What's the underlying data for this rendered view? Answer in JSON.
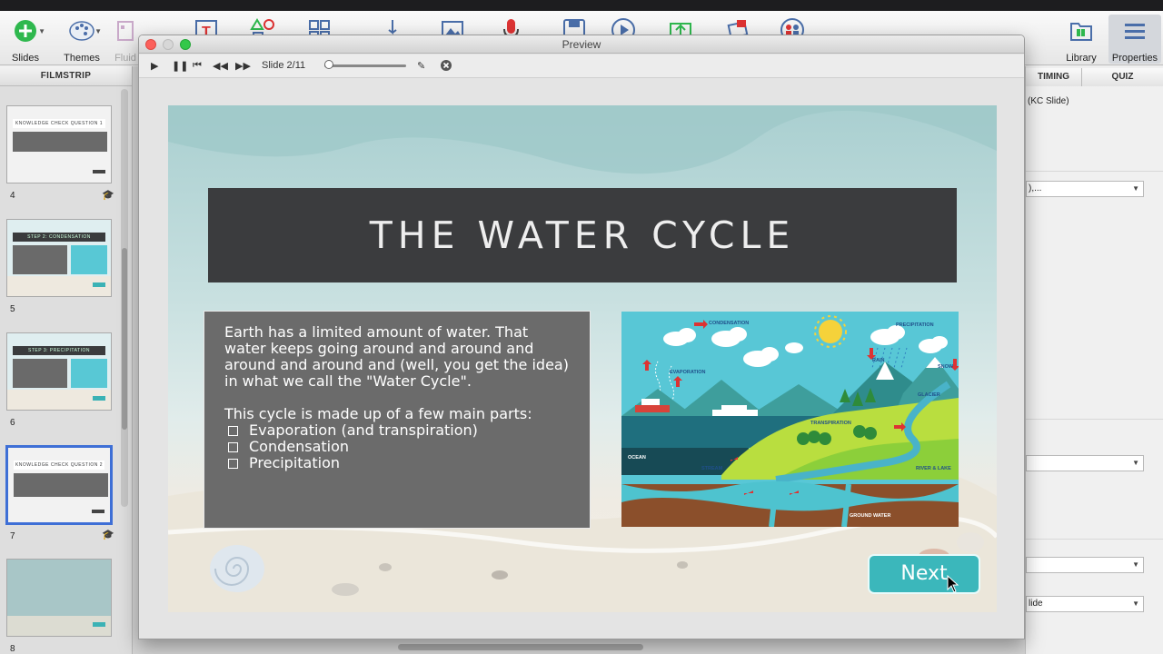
{
  "toolbar": {
    "items": [
      {
        "label": "Slides",
        "icon": "add-slide-icon"
      },
      {
        "label": "Themes",
        "icon": "palette-icon"
      },
      {
        "label": "Fluid",
        "icon": "fluid-boxes-icon"
      },
      {
        "label": "Library",
        "icon": "library-book-icon"
      },
      {
        "label": "Properties",
        "icon": "properties-list-icon"
      }
    ]
  },
  "filmstrip": {
    "header": "FILMSTRIP",
    "slides": [
      {
        "number": "4",
        "title": "KNOWLEDGE CHECK QUESTION 1",
        "quiz": true
      },
      {
        "number": "5",
        "title": "STEP 2: CONDENSATION",
        "quiz": false
      },
      {
        "number": "6",
        "title": "STEP 3: PRECIPITATION",
        "quiz": false
      },
      {
        "number": "7",
        "title": "KNOWLEDGE CHECK QUESTION 2",
        "quiz": true,
        "selected": true
      },
      {
        "number": "8",
        "title": "",
        "quiz": false
      }
    ]
  },
  "props": {
    "tabs": [
      "TIMING",
      "QUIZ"
    ],
    "subtitle": "(KC Slide)",
    "dropdowns": [
      "),...",
      "",
      "",
      "lide"
    ]
  },
  "preview": {
    "window_title": "Preview",
    "slide_counter": "Slide 2/11",
    "progress": 0.05
  },
  "slide": {
    "title": "THE WATER CYCLE",
    "intro": "Earth has a limited amount of water. That water keeps going around and around and around and around and (well, you get the idea) in what we call the \"Water Cycle\".",
    "list_heading": "This cycle is made up of a few main parts:",
    "list_items": [
      "Evaporation (and transpiration)",
      "Condensation",
      "Precipitation"
    ],
    "illustration_labels": {
      "condensation": "CONDENSATION",
      "precipitation": "PRECIPITATION",
      "evaporation": "EVAPORATION",
      "rain": "RAIN",
      "snow": "SNOW",
      "glacier": "GLACIER",
      "transpiration": "TRANSPIRATION",
      "ocean": "OCEAN",
      "stream": "STREAM",
      "river_lake": "RIVER & LAKE",
      "ground_water": "GROUND WATER"
    },
    "next_label": "Next"
  },
  "colors": {
    "accent_teal": "#3bb7bb",
    "title_bar": "#3b3c3e",
    "text_box": "#6b6b6b",
    "selection_blue": "#3e6fd6"
  }
}
